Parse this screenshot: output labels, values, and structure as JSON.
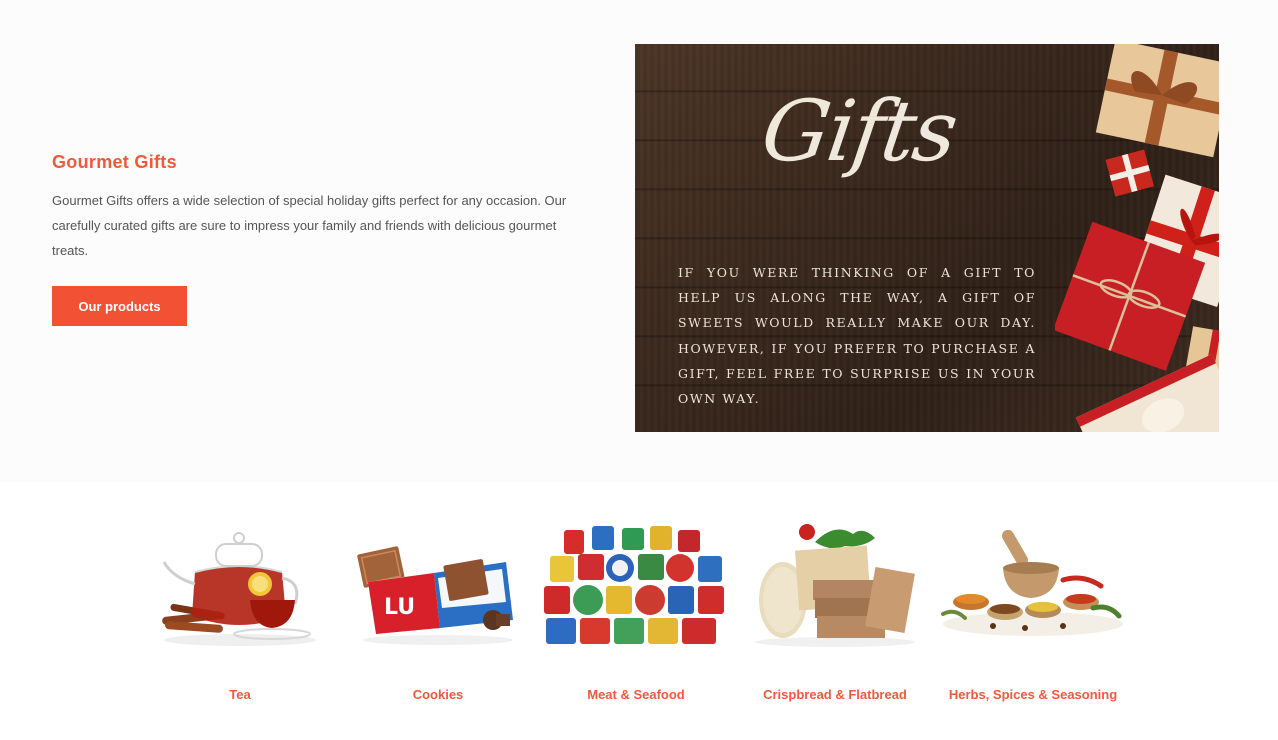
{
  "hero": {
    "title": "Gourmet Gifts",
    "description": "Gourmet Gifts offers a wide selection of special holiday gifts perfect for any occasion. Our carefully curated gifts are sure to impress your family and friends with delicious gourmet treats.",
    "button_label": "Our products",
    "accent_color": "#f25134"
  },
  "banner": {
    "script_title": "Gifts",
    "message": "IF YOU WERE THINKING OF A GIFT TO HELP US ALONG THE WAY, A GIFT OF SWEETS WOULD REALLY MAKE OUR DAY. HOWEVER, IF YOU PREFER TO PURCHASE A GIFT, FEEL FREE TO SURPRISE US IN YOUR OWN WAY."
  },
  "categories": [
    {
      "label": "Tea",
      "icon": "teapot-image"
    },
    {
      "label": "Cookies",
      "icon": "cookie-box-image"
    },
    {
      "label": "Meat & Seafood",
      "icon": "tin-cans-image"
    },
    {
      "label": "Crispbread & Flatbread",
      "icon": "crispbread-image"
    },
    {
      "label": "Herbs, Spices & Seasoning",
      "icon": "spices-image"
    }
  ]
}
